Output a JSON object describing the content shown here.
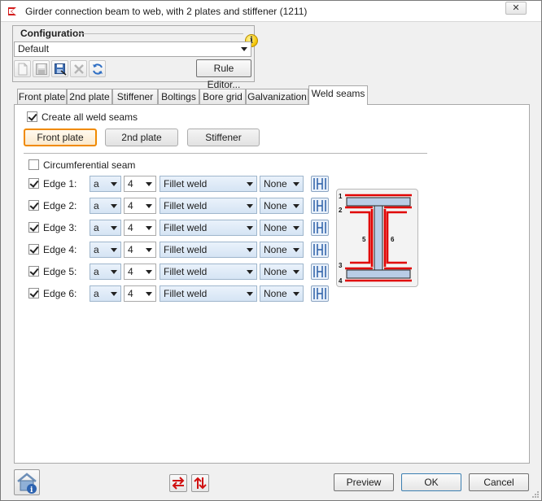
{
  "window": {
    "title": "Girder connection beam to web, with 2 plates and stiffener (1211)",
    "close_label": "✕"
  },
  "configuration": {
    "legend": "Configuration",
    "info_symbol": "i",
    "selected": "Default",
    "rule_editor_label": "Rule Editor...",
    "toolbar_icons": [
      "new-icon",
      "save-icon",
      "save-as-icon",
      "delete-icon",
      "refresh-icon"
    ]
  },
  "tabs": [
    "Front plate",
    "2nd plate",
    "Stiffener",
    "Boltings",
    "Bore grid",
    "Galvanization",
    "Weld seams"
  ],
  "active_tab": "Weld seams",
  "weld": {
    "create_all_label": "Create all weld seams",
    "create_all_checked": true,
    "segments": [
      "Front plate",
      "2nd plate",
      "Stiffener"
    ],
    "active_segment": "Front plate",
    "circumferential_label": "Circumferential seam",
    "circumferential_checked": false,
    "edges": [
      {
        "label": "Edge 1:",
        "checked": true,
        "type": "a",
        "size": "4",
        "weld": "Fillet weld",
        "finish": "None"
      },
      {
        "label": "Edge 2:",
        "checked": true,
        "type": "a",
        "size": "4",
        "weld": "Fillet weld",
        "finish": "None"
      },
      {
        "label": "Edge 3:",
        "checked": true,
        "type": "a",
        "size": "4",
        "weld": "Fillet weld",
        "finish": "None"
      },
      {
        "label": "Edge 4:",
        "checked": true,
        "type": "a",
        "size": "4",
        "weld": "Fillet weld",
        "finish": "None"
      },
      {
        "label": "Edge 5:",
        "checked": true,
        "type": "a",
        "size": "4",
        "weld": "Fillet weld",
        "finish": "None"
      },
      {
        "label": "Edge 6:",
        "checked": true,
        "type": "a",
        "size": "4",
        "weld": "Fillet weld",
        "finish": "None"
      }
    ],
    "diagram_labels": [
      "1",
      "2",
      "3",
      "4",
      "5",
      "6"
    ],
    "weld_color": "#e00000"
  },
  "buttons": {
    "preview": "Preview",
    "ok": "OK",
    "cancel": "Cancel"
  }
}
